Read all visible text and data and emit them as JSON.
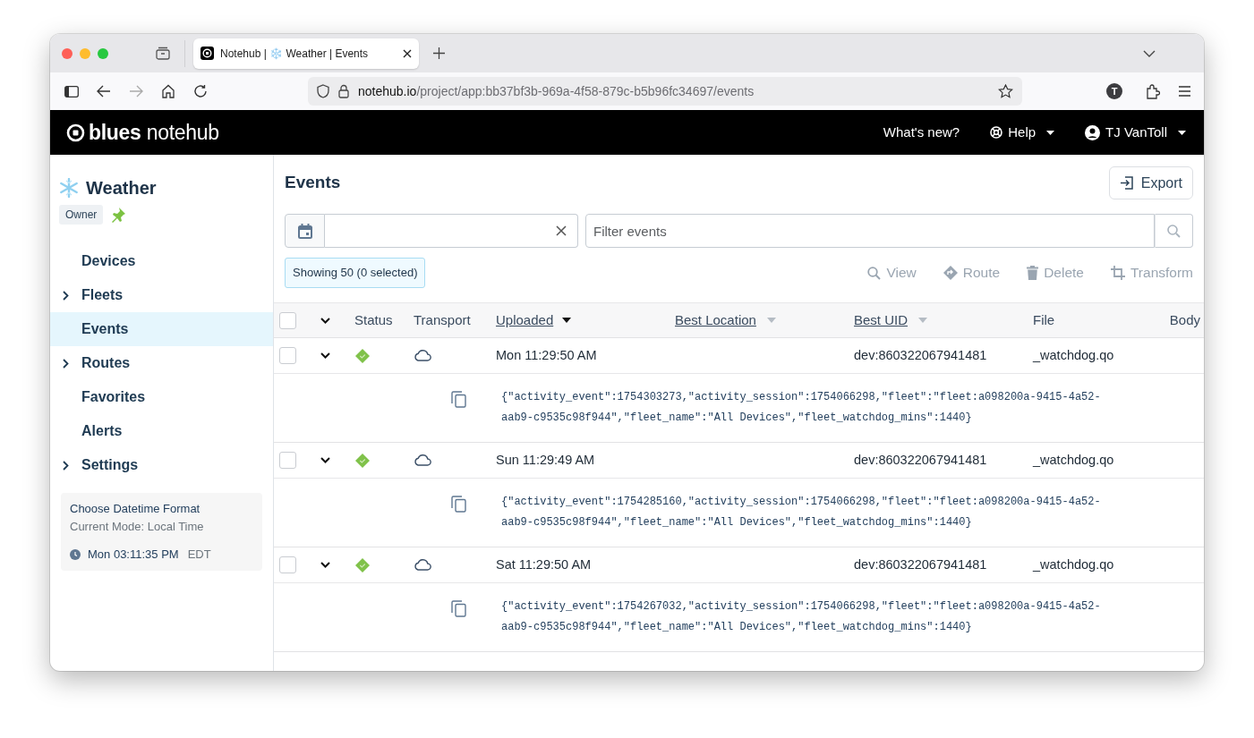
{
  "browser": {
    "tab_title": "Notehub | ❄️ Weather | Events",
    "url_host": "notehub.io",
    "url_path": "/project/app:bb37bf3b-969a-4f58-879c-b5b96fc34697/events",
    "profile_initial": "T"
  },
  "navbar": {
    "brand": "**blues** notehub",
    "links": [
      {
        "label": "What's new?",
        "kind": "link"
      },
      {
        "label": "Help",
        "kind": "help"
      },
      {
        "label": "TJ VanToll",
        "kind": "user"
      }
    ]
  },
  "sidebar": {
    "project_name": "Weather",
    "role": "Owner",
    "items": [
      {
        "label": "Devices",
        "expandable": false,
        "selected": false
      },
      {
        "label": "Fleets",
        "expandable": true,
        "selected": false
      },
      {
        "label": "Events",
        "expandable": false,
        "selected": true
      },
      {
        "label": "Routes",
        "expandable": true,
        "selected": false
      },
      {
        "label": "Favorites",
        "expandable": false,
        "selected": false
      },
      {
        "label": "Alerts",
        "expandable": false,
        "selected": false
      },
      {
        "label": "Settings",
        "expandable": true,
        "selected": false
      }
    ],
    "datetime": {
      "title": "Choose Datetime Format",
      "mode": "Current Mode: Local Time",
      "time": "Mon 03:11:35 PM",
      "zone": "EDT"
    }
  },
  "events": {
    "title": "Events",
    "export_label": "Export",
    "filter_placeholder": "Filter events",
    "showing": "Showing 50 (0 selected)",
    "actions": [
      {
        "label": "View",
        "kind": "view",
        "disabled": true
      },
      {
        "label": "Route",
        "kind": "route",
        "disabled": true
      },
      {
        "label": "Delete",
        "kind": "delete",
        "disabled": true
      },
      {
        "label": "Transform",
        "kind": "transform",
        "disabled": true
      }
    ],
    "header_checked": false,
    "columns": [
      {
        "label": "Status",
        "sortable": false
      },
      {
        "label": "Transport",
        "sortable": false
      },
      {
        "label": "Uploaded",
        "sortable": true,
        "sorted": true
      },
      {
        "label": "Best Location",
        "sortable": true,
        "sorted": false
      },
      {
        "label": "Best UID",
        "sortable": true,
        "sorted": false
      },
      {
        "label": "File",
        "sortable": false
      },
      {
        "label": "Body",
        "sortable": false
      }
    ],
    "rows": [
      {
        "checked": false,
        "uploaded": "Mon 11:29:50 AM",
        "best_uid": "dev:860322067941481",
        "file": "_watchdog.qo",
        "body": "{\"activity_event\":1754303273,\"activity_session\":1754066298,\"fleet\":\"fleet:a098200a-9415-4a52-aab9-c9535c98f944\",\"fleet_name\":\"All Devices\",\"fleet_watchdog_mins\":1440}"
      },
      {
        "checked": false,
        "uploaded": "Sun 11:29:49 AM",
        "best_uid": "dev:860322067941481",
        "file": "_watchdog.qo",
        "body": "{\"activity_event\":1754285160,\"activity_session\":1754066298,\"fleet\":\"fleet:a098200a-9415-4a52-aab9-c9535c98f944\",\"fleet_name\":\"All Devices\",\"fleet_watchdog_mins\":1440}"
      },
      {
        "checked": false,
        "uploaded": "Sat 11:29:50 AM",
        "best_uid": "dev:860322067941481",
        "file": "_watchdog.qo",
        "body": "{\"activity_event\":1754267032,\"activity_session\":1754066298,\"fleet\":\"fleet:a098200a-9415-4a52-aab9-c9535c98f944\",\"fleet_name\":\"All Devices\",\"fleet_watchdog_mins\":1440}"
      }
    ]
  }
}
